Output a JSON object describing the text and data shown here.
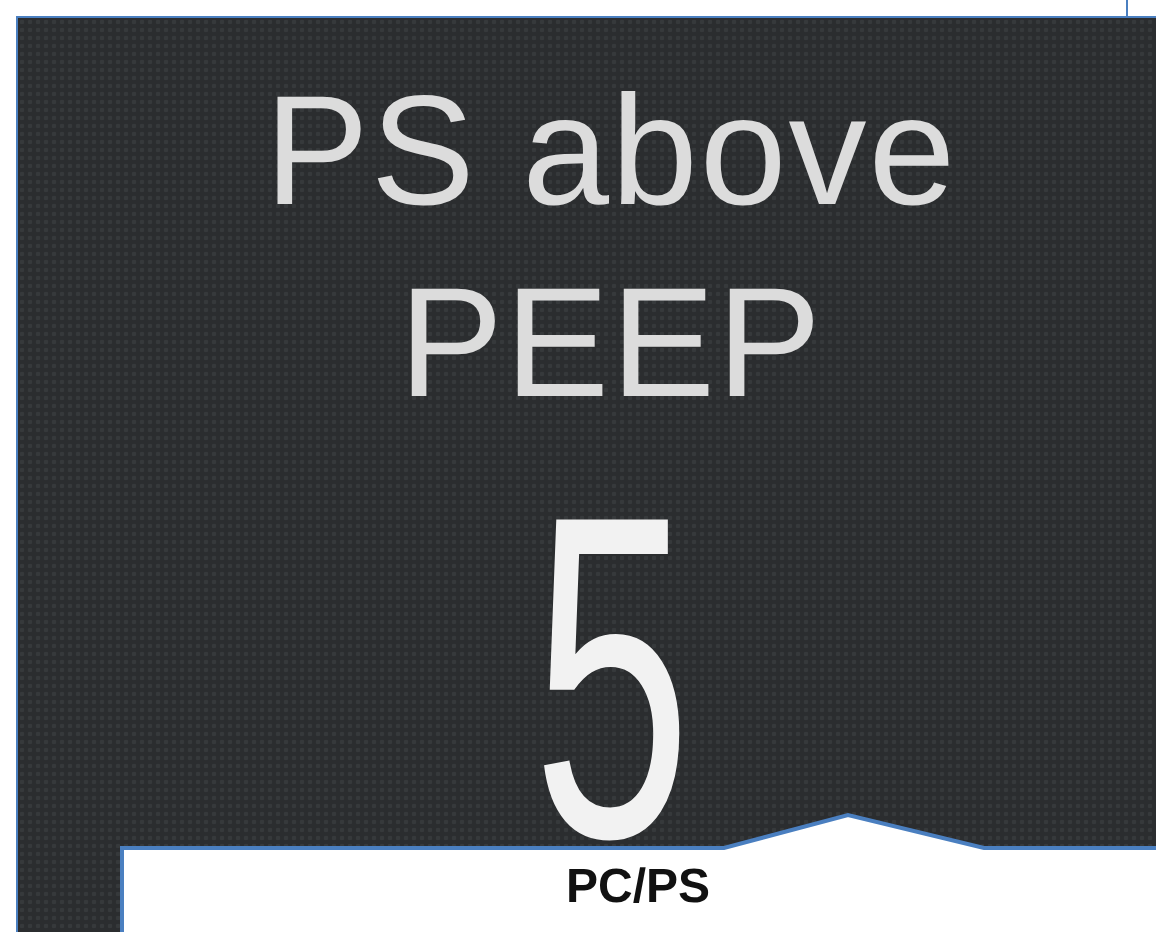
{
  "display": {
    "parameter_label": "PS above PEEP",
    "value": "5"
  },
  "callout": {
    "text": "PC/PS"
  }
}
